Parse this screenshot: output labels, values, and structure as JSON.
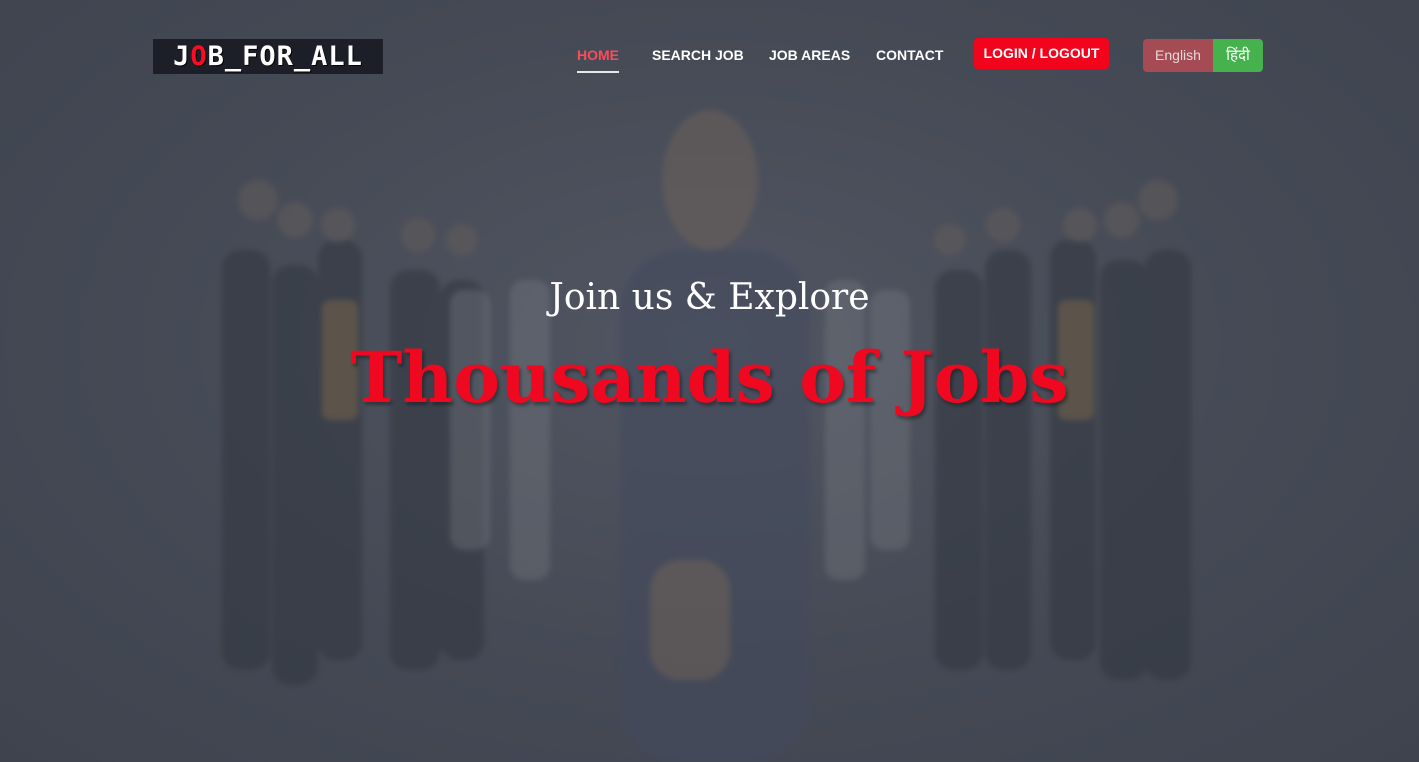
{
  "brand": {
    "logo_part1": "J",
    "logo_part2": "O",
    "logo_part3": "B_FOR_ALL"
  },
  "nav": {
    "items": [
      {
        "label": "HOME",
        "active": true
      },
      {
        "label": "SEARCH JOB",
        "active": false
      },
      {
        "label": "JOB AREAS",
        "active": false
      },
      {
        "label": "CONTACT",
        "active": false
      }
    ],
    "login_label": "LOGIN / LOGOUT"
  },
  "language": {
    "english_label": "English",
    "hindi_label": "हिंदी"
  },
  "hero": {
    "subtitle": "Join us & Explore",
    "headline": "Thousands of Jobs"
  },
  "colors": {
    "accent_red": "#f2041c",
    "active_nav": "#ff4a5a",
    "english_button": "#a54b53",
    "hindi_button": "#46b24d"
  }
}
